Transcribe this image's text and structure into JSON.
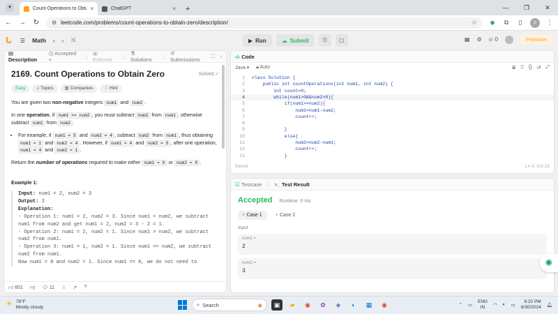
{
  "browser": {
    "tabs": [
      {
        "title": "Count Operations to Obtain Ze",
        "close": "×"
      },
      {
        "title": "ChatGPT",
        "close": "×"
      }
    ],
    "new_tab": "+",
    "url": "leetcode.com/problems/count-operations-to-obtain-zero/description/",
    "profile_initial": "c"
  },
  "lc_header": {
    "section": "Math",
    "run": "Run",
    "submit": "Submit",
    "streak": "0",
    "premium": "Premium"
  },
  "left_tabs": {
    "description": "Description",
    "accepted": "Accepted",
    "editorial": "Editorial",
    "solutions": "Solutions",
    "submissions": "Submissions"
  },
  "problem": {
    "title": "2169. Count Operations to Obtain Zero",
    "status": "Solved",
    "tags": [
      "Easy",
      "Topics",
      "Companies",
      "Hint"
    ],
    "p1_a": "You are given two ",
    "p1_b": "non-negative",
    "p1_c": " integers ",
    "p1_d": "num1",
    "p1_e": " and ",
    "p1_f": "num2",
    "p1_g": ".",
    "p2_a": "In one ",
    "p2_b": "operation",
    "p2_c": ", if ",
    "p2_d": "num1 >= num2",
    "p2_e": ", you must subtract ",
    "p2_f": "num2",
    "p2_g": " from ",
    "p2_h": "num1",
    "p2_i": ", otherwise subtract ",
    "p2_j": "num1",
    "p2_k": " from ",
    "p2_l": "num2",
    "p2_m": ".",
    "li_a": "For example, if ",
    "li_b": "num1 = 5",
    "li_c": " and ",
    "li_d": "num2 = 4",
    "li_e": ", subtract ",
    "li_f": "num2",
    "li_g": " from ",
    "li_h": "num1",
    "li_i": ", thus obtaining ",
    "li_j": "num1 = 1",
    "li_k": " and ",
    "li_l": "num2 = 4",
    "li_m": ". However, if ",
    "li_n": "num1 = 4",
    "li_o": " and ",
    "li_p": "num2 = 5",
    "li_q": ", after one operation, ",
    "li_r": "num1 = 4",
    "li_s": " and ",
    "li_t": "num2 = 1",
    "li_u": ".",
    "p3_a": "Return the ",
    "p3_b": "number of operations",
    "p3_c": " required to make either ",
    "p3_d": "num1 = 0",
    "p3_e": " or ",
    "p3_f": "num2 = 0",
    "p3_g": ".",
    "example_heading": "Example 1:",
    "ex_input_label": "Input:",
    "ex_input": " num1 = 2, num2 = 3",
    "ex_output_label": "Output:",
    "ex_output": " 3",
    "ex_expl_label": "Explanation:",
    "ex_expl": "- Operation 1: num1 = 2, num2 = 3. Since num1 < num2, we subtract num1 from num2 and get num1 = 2, num2 = 3 - 2 = 1.\n- Operation 2: num1 = 2, num2 = 1. Since num1 > num2, we subtract num2 from num1.\n- Operation 3: num1 = 1, num2 = 1. Since num1 == num2, we subtract num2 from num1.\nNow num1 = 0 and num2 = 1. Since num1 == 0, we do not need to"
  },
  "left_footer": {
    "likes": "601",
    "comments": "11"
  },
  "code": {
    "title": "Code",
    "language": "Java",
    "mode": "Auto",
    "lines": [
      {
        "n": "1",
        "t": "class Solution {"
      },
      {
        "n": "2",
        "t": "    public int countOperations(int num1, int num2) {"
      },
      {
        "n": "3",
        "t": "        int count=0;"
      },
      {
        "n": "4",
        "t": "        while(num1>0&&num2>0){"
      },
      {
        "n": "5",
        "t": "            if(num1>=num2){"
      },
      {
        "n": "6",
        "t": "                num1=num1-num2;"
      },
      {
        "n": "7",
        "t": "                count++;"
      },
      {
        "n": "8",
        "t": ""
      },
      {
        "n": "9",
        "t": "            }"
      },
      {
        "n": "10",
        "t": "            else{"
      },
      {
        "n": "11",
        "t": "                num2=num2-num1;"
      },
      {
        "n": "12",
        "t": "                count++;"
      },
      {
        "n": "13",
        "t": "            }"
      }
    ],
    "saved": "Saved",
    "cursor": "Ln 4, Col 23"
  },
  "result": {
    "tab_testcase": "Testcase",
    "tab_result": "Test Result",
    "status": "Accepted",
    "runtime": "Runtime: 0 ms",
    "case1": "Case 1",
    "case2": "Case 2",
    "input_label": "Input",
    "var1_name": "num1 =",
    "var1_value": "2",
    "var2_name": "num2 =",
    "var2_value": "3"
  },
  "taskbar": {
    "temp": "78°F",
    "weather": "Mostly cloudy",
    "search": "Search",
    "lang1": "ENG",
    "lang2": "IN",
    "time": "8:20 PM",
    "date": "6/30/2024"
  },
  "colors": {
    "accent_orange": "#ffa116",
    "accepted_green": "#2cbb5d",
    "easy_teal": "#00b8a3"
  }
}
